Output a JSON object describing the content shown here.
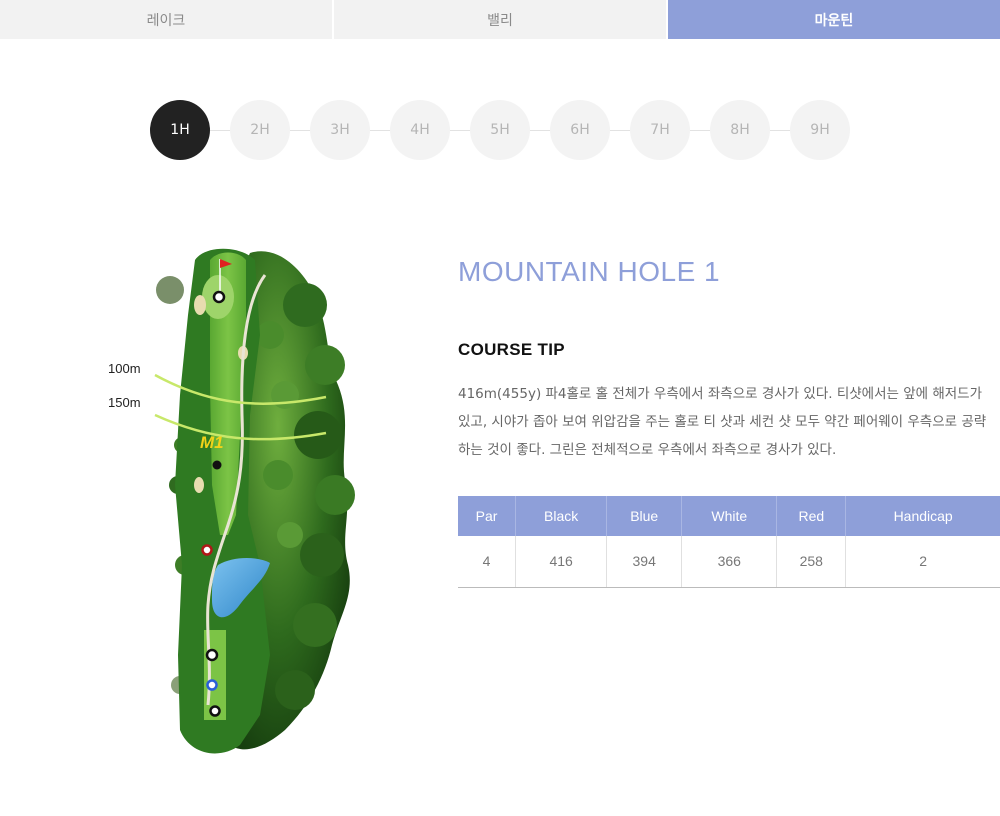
{
  "tabs": [
    {
      "label": "레이크",
      "active": false
    },
    {
      "label": "밸리",
      "active": false
    },
    {
      "label": "마운틴",
      "active": true
    }
  ],
  "holes": [
    "1H",
    "2H",
    "3H",
    "4H",
    "5H",
    "6H",
    "7H",
    "8H",
    "9H"
  ],
  "active_hole_index": 0,
  "map": {
    "label_100": "100m",
    "label_150": "150m",
    "marker": "M1",
    "icons": [
      "tree-icon",
      "flag-icon",
      "water-hazard-icon"
    ]
  },
  "hole": {
    "title": "MOUNTAIN HOLE 1",
    "tip_heading": "COURSE TIP",
    "tip_text": "416m(455y) 파4홀로 홀 전체가 우측에서 좌측으로 경사가 있다. 티샷에서는 앞에 해저드가\n있고, 시야가 좁아 보여 위압감을 주는 홀로 티 샷과 세컨 샷 모두 약간 페어웨이 우측으로 공략\n하는 것이 좋다. 그린은 전체적으로 우측에서 좌측으로 경사가 있다."
  },
  "table": {
    "headers": [
      "Par",
      "Black",
      "Blue",
      "White",
      "Red",
      "Handicap"
    ],
    "values": [
      "4",
      "416",
      "394",
      "366",
      "258",
      "2"
    ]
  },
  "colors": {
    "accent": "#8e9fd9",
    "active_hole": "#222222",
    "fairway": "#5aa832",
    "rough": "#2f6b1f"
  }
}
